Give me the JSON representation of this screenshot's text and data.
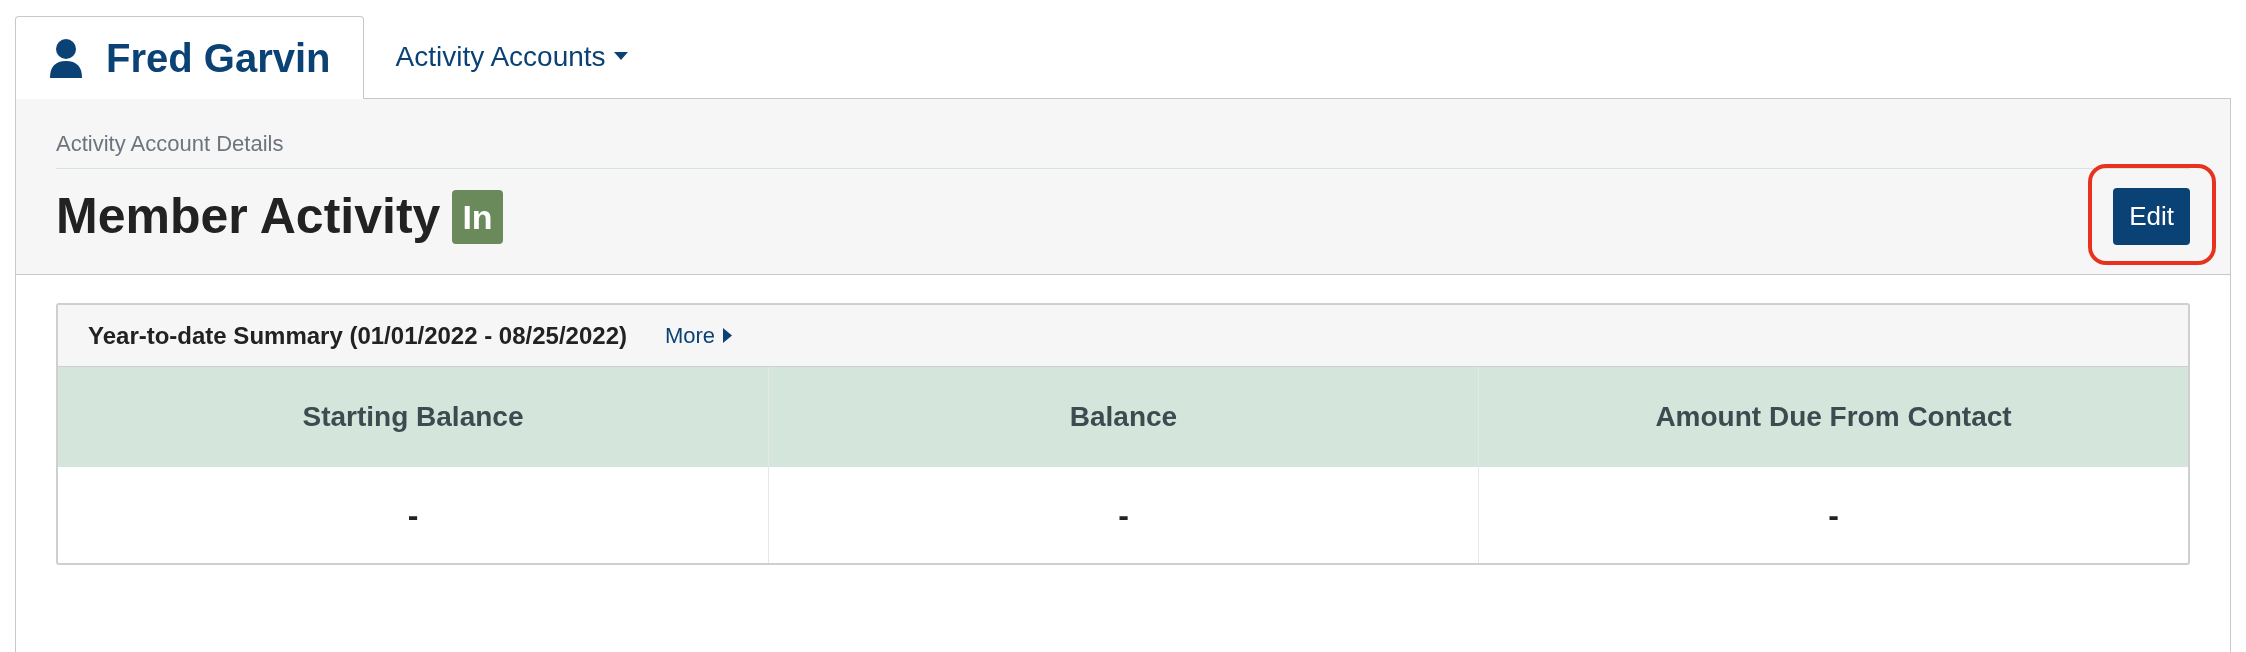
{
  "tabs": [
    {
      "label": "Fred Garvin",
      "kind": "person",
      "selected": true
    },
    {
      "label": "Activity Accounts",
      "kind": "dropdown",
      "selected": false
    }
  ],
  "header": {
    "breadcrumb": "Activity Account Details",
    "title": "Member Activity",
    "status_badge": "In",
    "edit_button": {
      "label": "Edit",
      "highlighted": true
    }
  },
  "summary": {
    "title": "Year-to-date Summary (01/01/2022 - 08/25/2022)",
    "more_link": "More",
    "columns": [
      "Starting Balance",
      "Balance",
      "Amount Due From Contact"
    ],
    "rows": [
      [
        "-",
        "-",
        "-"
      ]
    ]
  }
}
